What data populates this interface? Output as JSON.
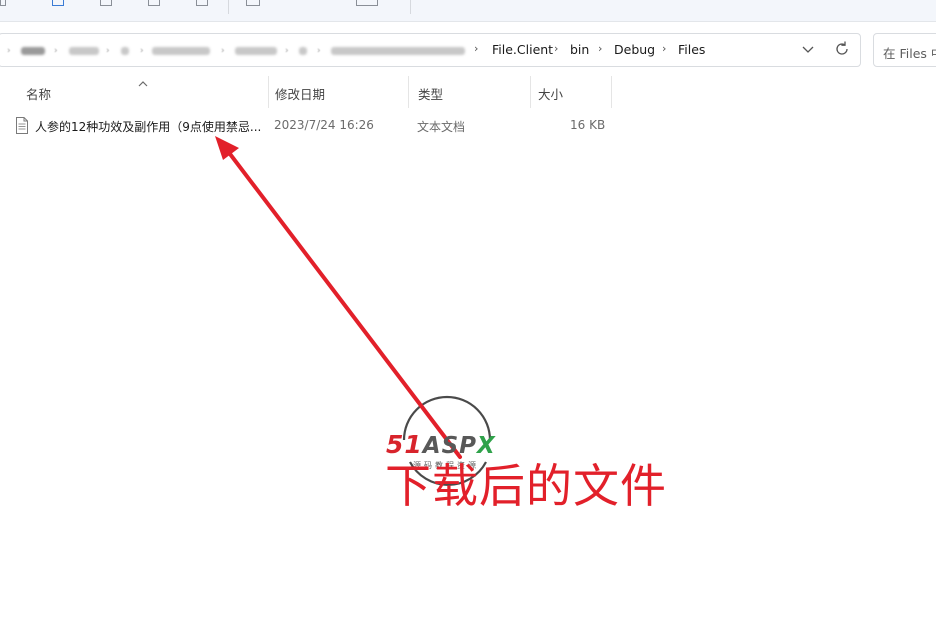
{
  "address_bar": {
    "breadcrumbs": [
      "File.Client",
      "bin",
      "Debug",
      "Files"
    ]
  },
  "search": {
    "placeholder": "在 Files 中"
  },
  "columns": {
    "name": "名称",
    "date": "修改日期",
    "type": "类型",
    "size": "大小"
  },
  "files": [
    {
      "name": "人参的12种功效及副作用（9点使用禁忌...",
      "date": "2023/7/24 16:26",
      "type": "文本文档",
      "size": "16 KB"
    }
  ],
  "annotation": {
    "text": "下载后的文件",
    "color": "#e2202a"
  },
  "watermark": {
    "logo_number": "51",
    "logo_letters": "ASP",
    "logo_last": "X",
    "tagline": "源码教程资源"
  },
  "icons": {
    "file": "text-file-icon",
    "dropdown": "chevron-down-icon",
    "refresh": "refresh-icon",
    "sort": "sort-ascending-icon",
    "arrow": "annotation-arrow"
  }
}
